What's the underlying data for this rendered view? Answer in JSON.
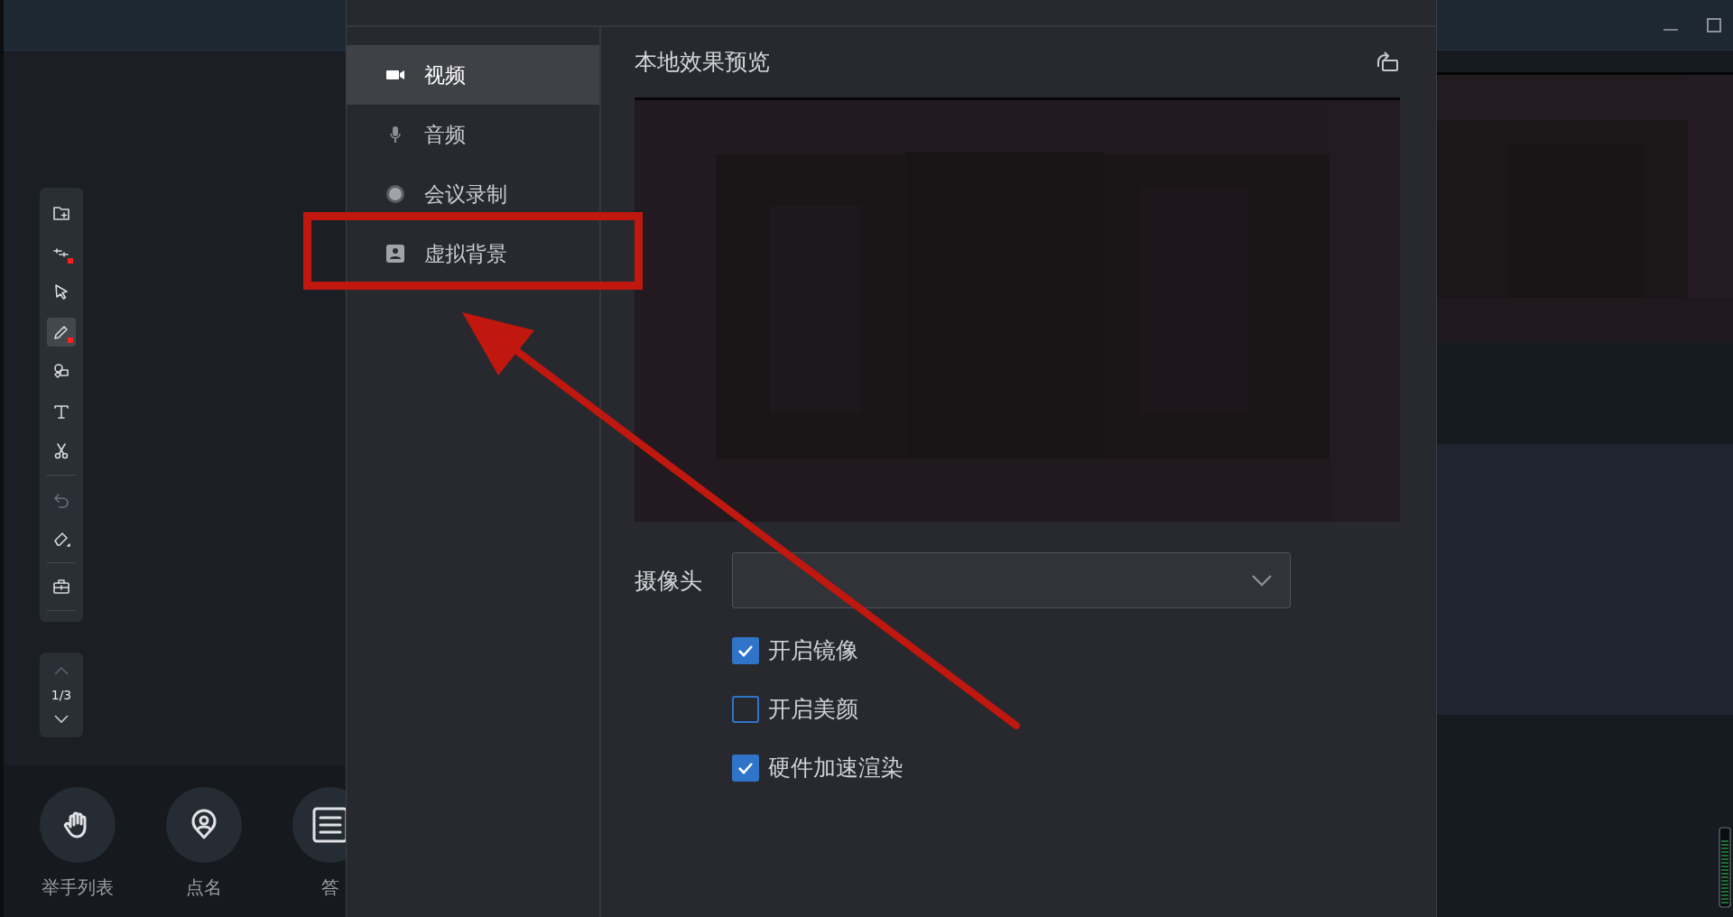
{
  "toolbar": {
    "groups": [
      {
        "tools": [
          {
            "selected": false,
            "marked": false
          },
          {
            "selected": false,
            "marked": true
          },
          {
            "selected": false,
            "marked": false
          },
          {
            "selected": true,
            "marked": true
          },
          {
            "selected": false,
            "marked": false
          },
          {
            "selected": false,
            "marked": false
          },
          {
            "selected": false,
            "marked": false
          }
        ]
      },
      {
        "tools": [
          {
            "selected": false,
            "marked": false
          },
          {
            "selected": false,
            "marked": false
          }
        ]
      },
      {
        "tools": [
          {
            "selected": false,
            "marked": false
          }
        ]
      }
    ]
  },
  "page_indicator": "1/3",
  "bottom_actions": [
    {
      "kind": "hand",
      "label": "举手列表"
    },
    {
      "kind": "pin",
      "label": "点名"
    },
    {
      "kind": "sheet",
      "label": "答"
    }
  ],
  "settings": {
    "nav": [
      {
        "kind": "video",
        "label": "视频",
        "selected": true
      },
      {
        "kind": "mic",
        "label": "音频",
        "selected": false
      },
      {
        "kind": "record",
        "label": "会议录制",
        "selected": false
      },
      {
        "kind": "background",
        "label": "虚拟背景",
        "selected": false
      }
    ],
    "preview_title": "本地效果预览",
    "camera_label": "摄像头",
    "options": [
      {
        "label": "开启镜像",
        "checked": true
      },
      {
        "label": "开启美颜",
        "checked": false
      },
      {
        "label": "硬件加速渲染",
        "checked": true
      }
    ]
  }
}
